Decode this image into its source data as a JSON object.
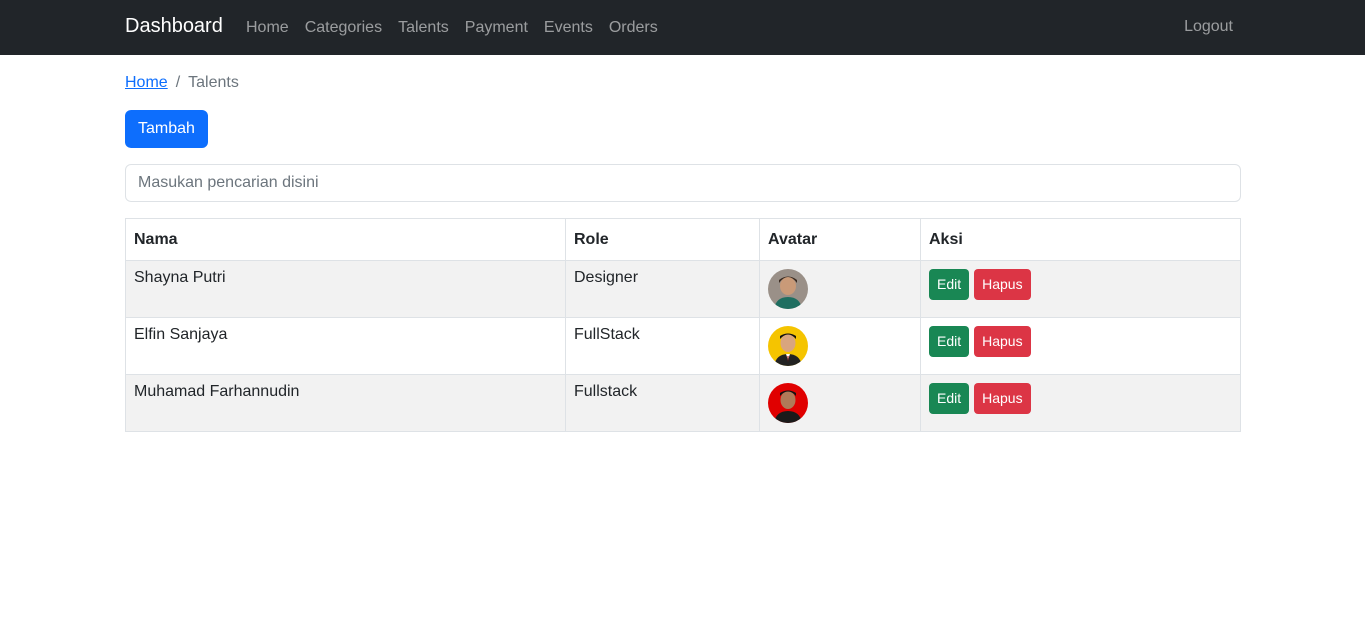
{
  "navbar": {
    "brand": "Dashboard",
    "links": [
      "Home",
      "Categories",
      "Talents",
      "Payment",
      "Events",
      "Orders"
    ],
    "logout": "Logout"
  },
  "breadcrumb": {
    "home": "Home",
    "separator": "/",
    "current": "Talents"
  },
  "actions": {
    "add_label": "Tambah"
  },
  "search": {
    "placeholder": "Masukan pencarian disini",
    "value": ""
  },
  "table": {
    "headers": [
      "Nama",
      "Role",
      "Avatar",
      "Aksi"
    ],
    "rows": [
      {
        "nama": "Shayna Putri",
        "role": "Designer",
        "avatar_bg": "#8a8a8a",
        "edit": "Edit",
        "hapus": "Hapus"
      },
      {
        "nama": "Elfin Sanjaya",
        "role": "FullStack",
        "avatar_bg": "#f5c400",
        "edit": "Edit",
        "hapus": "Hapus"
      },
      {
        "nama": "Muhamad Farhannudin",
        "role": "Fullstack",
        "avatar_bg": "#e00000",
        "edit": "Edit",
        "hapus": "Hapus"
      }
    ]
  },
  "colors": {
    "navbar_bg": "#212529",
    "primary": "#0d6efd",
    "success": "#198754",
    "danger": "#dc3545"
  }
}
